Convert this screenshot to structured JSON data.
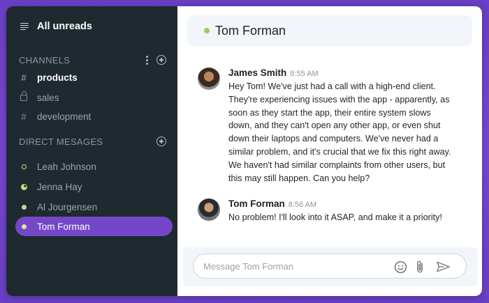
{
  "sidebar": {
    "all_unreads": "All unreads",
    "channels_heading": "CHANNELS",
    "channels": [
      {
        "name": "products",
        "icon": "hash-icon",
        "active": true
      },
      {
        "name": "sales",
        "icon": "lock-icon",
        "active": false
      },
      {
        "name": "development",
        "icon": "hash-icon",
        "active": false
      }
    ],
    "dm_heading": "DIRECT MESAGES",
    "direct_messages": [
      {
        "name": "Leah Johnson",
        "status": "ring"
      },
      {
        "name": "Jenna Hay",
        "status": "partial"
      },
      {
        "name": "Al Jourgensen",
        "status": "online"
      },
      {
        "name": "Tom Forman",
        "status": "online",
        "active": true
      }
    ],
    "hash_glyph": "#"
  },
  "chat": {
    "title": "Tom Forman",
    "messages": [
      {
        "author": "James Smith",
        "time": "8:55 AM",
        "text": "Hey Tom! We've just had a call with a high-end client. They're experiencing issues with the app - apparently, as soon as they start the app, their entire system slows down, and they can't open any other app, or even shut down their laptops and computers. We've never had a similar problem, and it's crucial that we fix this right away. We haven't had similar complaints from other users, but this may still happen. Can you help?"
      },
      {
        "author": "Tom Forman",
        "time": "8:56 AM",
        "text": "No problem! I'll look into it ASAP, and make it a priority!"
      }
    ],
    "composer_placeholder": "Message Tom Forman"
  },
  "colors": {
    "background": "#6a3fc4",
    "sidebar": "#1e2a30",
    "active_item": "#7447c8",
    "online": "#9ccc65"
  }
}
